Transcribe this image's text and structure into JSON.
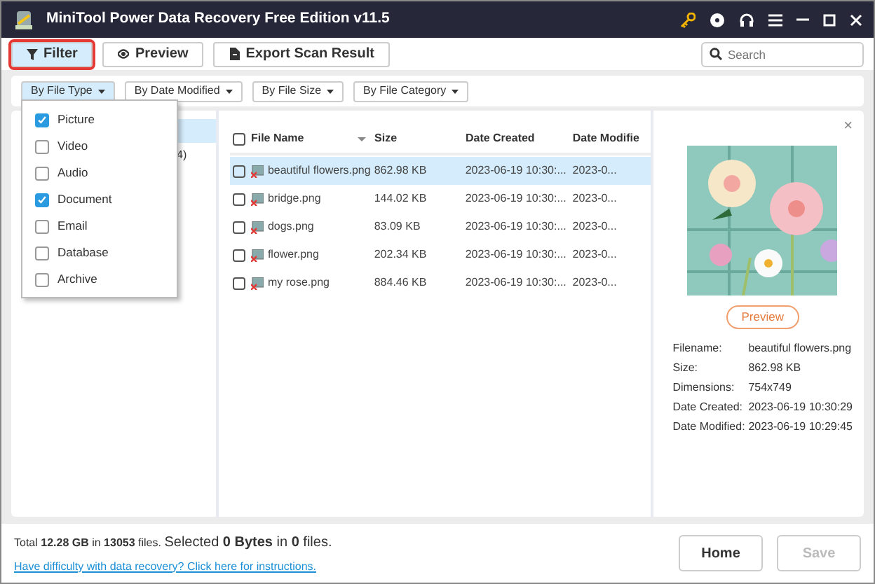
{
  "window": {
    "title": "MiniTool Power Data Recovery Free Edition v11.5"
  },
  "toolbar": [
    {
      "label": "Filter",
      "kind": "filter",
      "selected": true
    },
    {
      "label": "Preview",
      "kind": "preview",
      "selected": false
    },
    {
      "label": "Export Scan Result",
      "kind": "export",
      "selected": false
    }
  ],
  "search": {
    "placeholder": "Search"
  },
  "filters": [
    {
      "label": "By File Type",
      "selected": true
    },
    {
      "label": "By Date Modified",
      "selected": false
    },
    {
      "label": "By File Size",
      "selected": false
    },
    {
      "label": "By File Category",
      "selected": false
    }
  ],
  "file_type_menu": [
    {
      "label": "Picture",
      "checked": true
    },
    {
      "label": "Video",
      "checked": false
    },
    {
      "label": "Audio",
      "checked": false
    },
    {
      "label": "Document",
      "checked": true
    },
    {
      "label": "Email",
      "checked": false
    },
    {
      "label": "Database",
      "checked": false
    },
    {
      "label": "Archive",
      "checked": false
    }
  ],
  "tree": [
    {
      "selected": true
    },
    {
      "label": "4)",
      "selected": false
    }
  ],
  "table": {
    "select_all_checked": false,
    "columns": [
      "File Name",
      "Size",
      "Date Created",
      "Date Modifie"
    ],
    "rows": [
      {
        "name": "beautiful flowers.png",
        "size": "862.98 KB",
        "created": "2023-06-19 10:30:...",
        "modified": "2023-0...",
        "selected": true,
        "checked": false
      },
      {
        "name": "bridge.png",
        "size": "144.02 KB",
        "created": "2023-06-19 10:30:...",
        "modified": "2023-0...",
        "selected": false,
        "checked": false
      },
      {
        "name": "dogs.png",
        "size": "83.09 KB",
        "created": "2023-06-19 10:30:...",
        "modified": "2023-0...",
        "selected": false,
        "checked": false
      },
      {
        "name": "flower.png",
        "size": "202.34 KB",
        "created": "2023-06-19 10:30:...",
        "modified": "2023-0...",
        "selected": false,
        "checked": false
      },
      {
        "name": "my rose.png",
        "size": "884.46 KB",
        "created": "2023-06-19 10:30:...",
        "modified": "2023-0...",
        "selected": false,
        "checked": false
      }
    ]
  },
  "preview": {
    "close": "×",
    "button": "Preview",
    "details": [
      {
        "label": "Filename:",
        "value": "beautiful flowers.png"
      },
      {
        "label": "Size:",
        "value": "862.98 KB"
      },
      {
        "label": "Dimensions:",
        "value": "754x749"
      },
      {
        "label": "Date Created:",
        "value": "2023-06-19 10:30:29"
      },
      {
        "label": "Date Modified:",
        "value": "2023-06-19 10:29:45"
      }
    ]
  },
  "status": {
    "total": "Total **12.28 GB** in **13053** files.",
    "selected": "Selected **0 Bytes** in **0** files.",
    "link": "Have difficulty with data recovery? Click here for instructions."
  },
  "buttons": [
    {
      "label": "Home",
      "disabled": false
    },
    {
      "label": "Save",
      "disabled": true
    }
  ]
}
